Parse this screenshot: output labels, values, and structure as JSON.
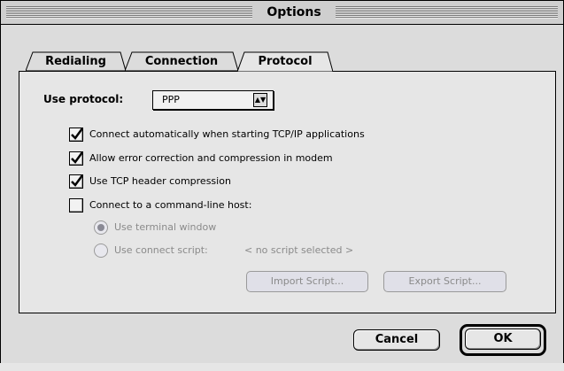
{
  "window": {
    "title": "Options"
  },
  "tabs": [
    {
      "label": "Redialing",
      "active": false
    },
    {
      "label": "Connection",
      "active": false
    },
    {
      "label": "Protocol",
      "active": true
    }
  ],
  "protocol": {
    "use_label": "Use protocol:",
    "selected": "PPP",
    "options": [
      {
        "label": "Connect automatically when starting TCP/IP applications",
        "checked": true
      },
      {
        "label": "Allow error correction and compression in modem",
        "checked": true
      },
      {
        "label": "Use TCP header compression",
        "checked": true
      },
      {
        "label": "Connect to a command-line host:",
        "checked": false
      }
    ],
    "radios": [
      {
        "label": "Use terminal window",
        "selected": true,
        "enabled": false
      },
      {
        "label": "Use connect script:",
        "selected": false,
        "enabled": false
      }
    ],
    "script_status": "< no script selected >",
    "import_label": "Import Script...",
    "export_label": "Export Script..."
  },
  "buttons": {
    "cancel": "Cancel",
    "ok": "OK"
  },
  "icons": {
    "popup_arrow": "popup-arrows-icon",
    "check": "checkmark-icon"
  },
  "colors": {
    "background": "#dcdcdc",
    "panel": "#e6e6e6",
    "disabled_text": "#8a8a8a"
  }
}
